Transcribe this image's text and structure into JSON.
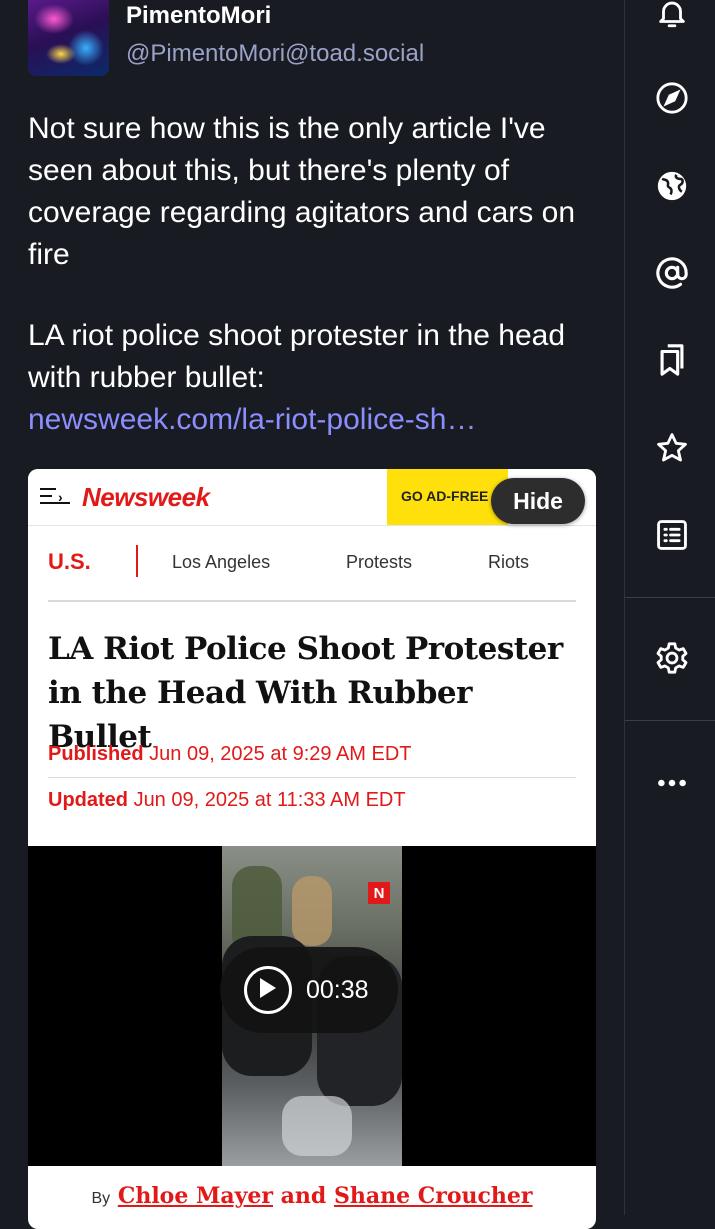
{
  "post": {
    "display_name": "PimentoMori",
    "handle": "@PimentoMori@toad.social",
    "paragraph1": "Not sure how this is the only article I've seen about this, but there's plenty of coverage regarding agitators and cars on fire",
    "paragraph2": "LA riot police shoot protester in the head with rubber bullet:",
    "link_text": "newsweek.com/la-riot-police-sh…"
  },
  "attachment": {
    "logo": "Newsweek",
    "ad_free": "GO AD-FREE",
    "hide_label": "Hide",
    "category_main": "U.S.",
    "categories": [
      "Los Angeles",
      "Protests",
      "Riots"
    ],
    "headline": "LA Riot Police Shoot Protester in the Head With Rubber Bullet",
    "published_label": "Published",
    "published_date": "Jun 09, 2025 at 9:29 AM EDT",
    "updated_label": "Updated",
    "updated_date": "Jun 09, 2025 at 11:33 AM EDT",
    "video_badge": "N",
    "video_duration": "00:38",
    "byline_by": "By",
    "author1": "Chloe Mayer",
    "byline_and": "and",
    "author2": "Shane Croucher"
  },
  "colors": {
    "background": "#191b22",
    "link": "#8c8dff",
    "handle": "#9ba2c8",
    "newsweek_red": "#e11919",
    "ad_yellow": "#ffe00a"
  },
  "rail_icons": [
    "bell-icon",
    "compass-icon",
    "globe-icon",
    "at-icon",
    "bookmarks-icon",
    "star-icon",
    "list-icon",
    "gear-icon",
    "more-icon"
  ]
}
